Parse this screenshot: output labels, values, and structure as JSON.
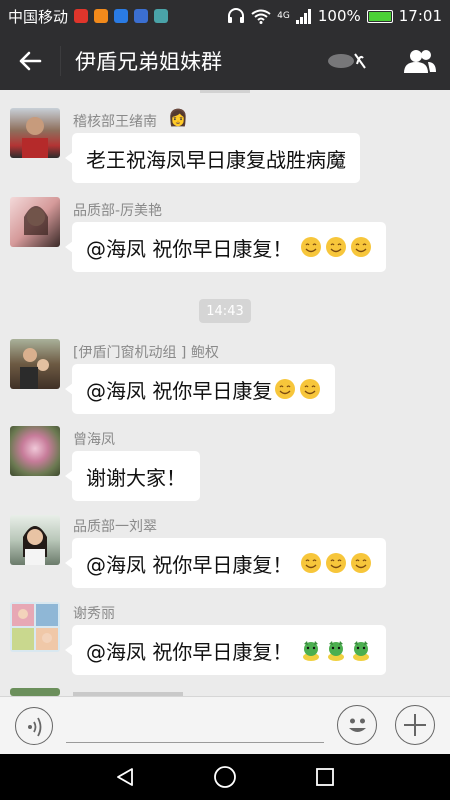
{
  "status_bar": {
    "carrier": "中国移动",
    "network": "4G",
    "battery": "100%",
    "time": "17:01"
  },
  "header": {
    "title": "伊盾兄弟姐妹群",
    "back_icon": "back-arrow-icon",
    "members_icon": "group-members-icon"
  },
  "messages": [
    {
      "sender": "稽核部王绪南",
      "text": "老王祝海凤早日康复战胜病魔",
      "emoji": "",
      "emoji_count": 0
    },
    {
      "sender": "品质部-厉美艳",
      "text": "@海凤 祝你早日康复！",
      "emoji": "smile-emoji",
      "emoji_count": 3
    },
    {
      "sender": "[伊盾门窗机动组 ] 鲍权",
      "text": "@海凤 祝你早日康复",
      "emoji": "smile-emoji",
      "emoji_count": 2
    },
    {
      "sender": "曾海凤",
      "text": "谢谢大家！",
      "emoji": "",
      "emoji_count": 0
    },
    {
      "sender": "品质部一刘翠",
      "text": "@海凤 祝你早日康复！",
      "emoji": "smile-emoji",
      "emoji_count": 3
    },
    {
      "sender": "谢秀丽",
      "text": "@海凤 祝你早日康复！",
      "emoji": "pig-head-emoji",
      "emoji_count": 3
    }
  ],
  "time_divider": "14:43",
  "input_bar": {
    "placeholder": "",
    "voice_icon": "voice-icon",
    "emoji_icon": "emoji-icon",
    "plus_icon": "plus-icon"
  },
  "colors": {
    "header_bg": "#2e2e30",
    "chat_bg": "#ebebeb",
    "bubble_bg": "#ffffff",
    "sender_text": "#8a8a8a"
  }
}
